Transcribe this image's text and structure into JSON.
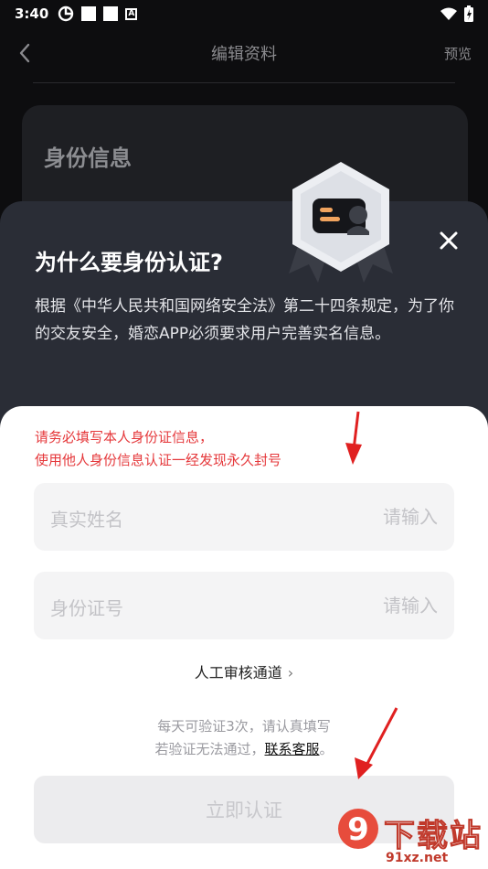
{
  "status_bar": {
    "time": "3:40",
    "notif_icon": "A"
  },
  "nav": {
    "title": "编辑资料",
    "preview": "预览"
  },
  "background_card": {
    "title": "身份信息"
  },
  "info_sheet": {
    "title": "为什么要身份认证?",
    "description": "根据《中华人民共和国网络安全法》第二十四条规定，为了你的交友安全，婚恋APP必须要求用户完善实名信息。"
  },
  "form": {
    "warning_line1": "请务必填写本人身份证信息，",
    "warning_line2": "使用他人身份信息认证一经发现永久封号",
    "name_field": {
      "label": "真实姓名",
      "placeholder": "请输入"
    },
    "id_field": {
      "label": "身份证号",
      "placeholder": "请输入"
    },
    "manual_review": "人工审核通道",
    "manual_chevron": "›",
    "hint_line1": "每天可验证3次，请认真填写",
    "hint_line2_prefix": "若验证无法通过，",
    "hint_contact": "联系客服",
    "hint_line2_suffix": "。",
    "submit": "立即认证"
  },
  "watermark": {
    "text": "下载站",
    "url": "91xz.net",
    "logo": "9"
  },
  "colors": {
    "warning": "#e5383b",
    "arrow": "#e02020",
    "sheet_dark": "#2a2d36"
  }
}
